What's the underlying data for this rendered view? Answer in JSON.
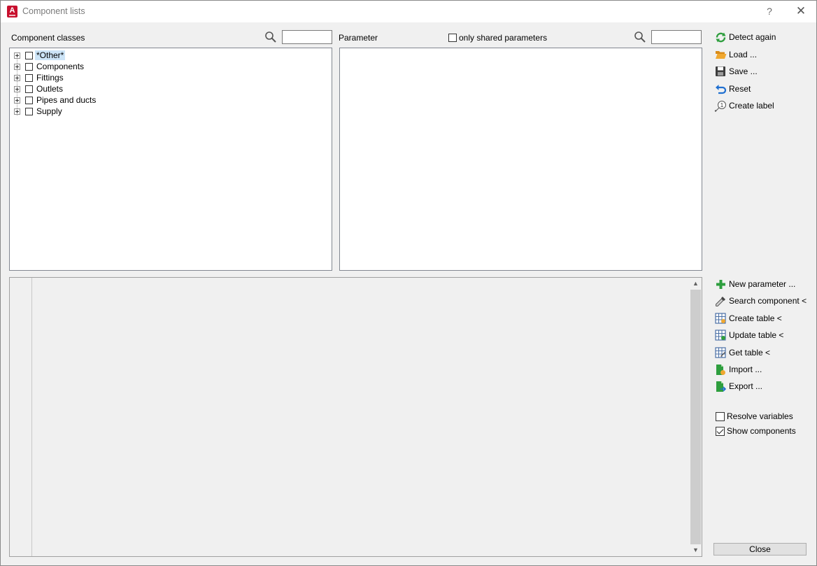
{
  "window": {
    "title": "Component lists",
    "help_label": "?",
    "close_label": "✕",
    "app_icon_letter": "A"
  },
  "component_classes": {
    "label": "Component classes",
    "search_value": "",
    "items": [
      {
        "label": "*Other*",
        "selected": true
      },
      {
        "label": "Components",
        "selected": false
      },
      {
        "label": "Fittings",
        "selected": false
      },
      {
        "label": "Outlets",
        "selected": false
      },
      {
        "label": "Pipes and ducts",
        "selected": false
      },
      {
        "label": "Supply",
        "selected": false
      }
    ]
  },
  "parameter": {
    "label": "Parameter",
    "shared_only_label": "only shared parameters",
    "shared_only_checked": false,
    "search_value": ""
  },
  "actions_top": [
    {
      "label": "Detect again",
      "icon": "refresh-icon"
    },
    {
      "label": "Load ...",
      "icon": "folder-icon"
    },
    {
      "label": "Save ...",
      "icon": "floppy-icon"
    },
    {
      "label": "Reset",
      "icon": "undo-icon"
    },
    {
      "label": "Create label",
      "icon": "label-icon"
    }
  ],
  "actions_bottom": [
    {
      "label": "New parameter ...",
      "icon": "plus-icon"
    },
    {
      "label": "Search component <",
      "icon": "eyedropper-icon"
    },
    {
      "label": "Create table <",
      "icon": "table-create-icon"
    },
    {
      "label": "Update table <",
      "icon": "table-update-icon"
    },
    {
      "label": "Get table <",
      "icon": "table-get-icon"
    },
    {
      "label": "Import ...",
      "icon": "import-icon"
    },
    {
      "label": "Export ...",
      "icon": "export-icon"
    }
  ],
  "options": {
    "resolve_variables_label": "Resolve variables",
    "resolve_variables_checked": false,
    "show_components_label": "Show components",
    "show_components_checked": true
  },
  "footer": {
    "close_label": "Close"
  },
  "colors": {
    "accent_green": "#2e9e3e",
    "folder_orange": "#f0a830",
    "selection_blue": "#cce4f7",
    "app_red": "#c8102e"
  }
}
